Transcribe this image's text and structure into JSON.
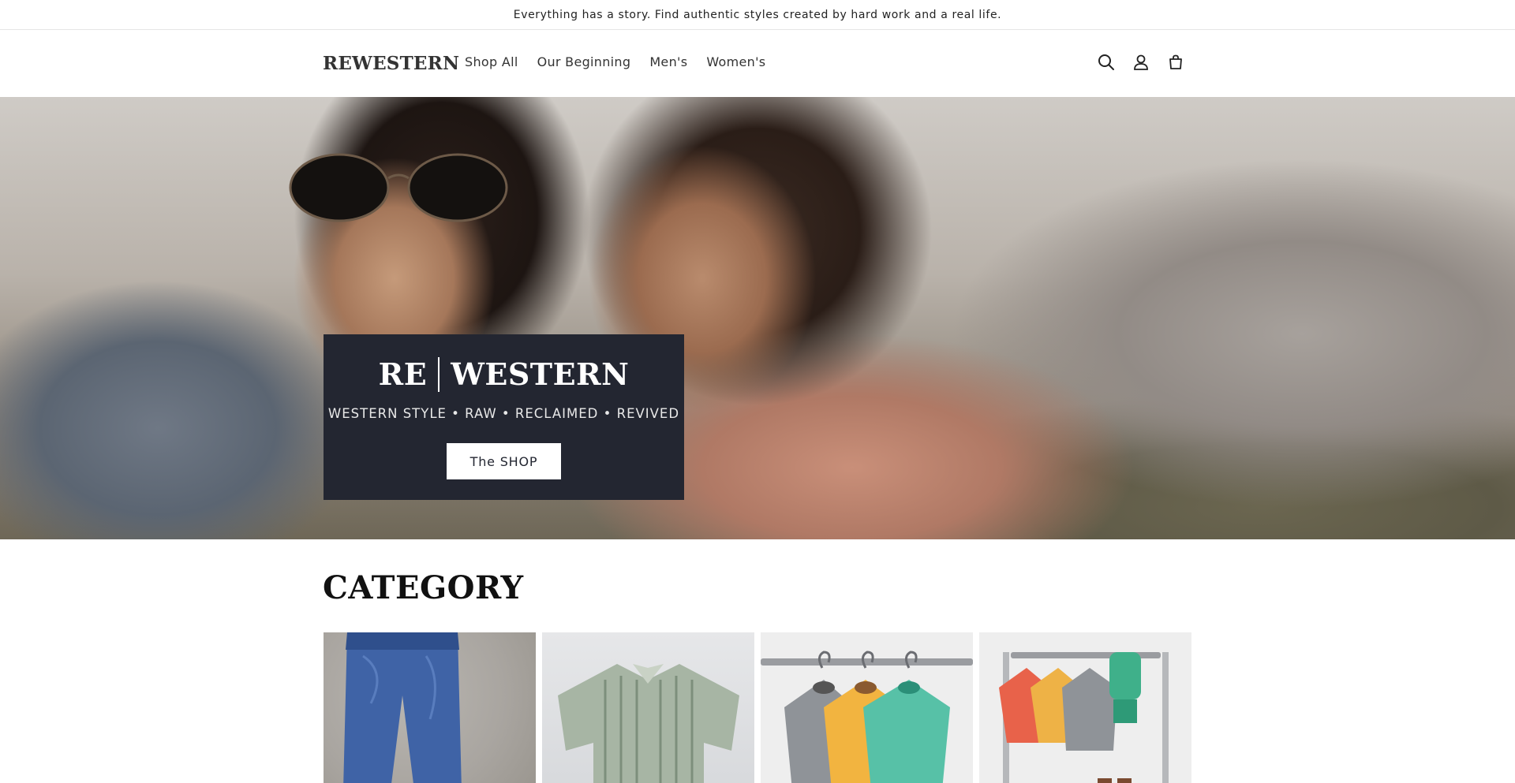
{
  "announcement": {
    "text": "Everything has a story. Find authentic styles created by hard work and a real life."
  },
  "header": {
    "logo": "REWESTERN",
    "nav": [
      {
        "label": "Shop All"
      },
      {
        "label": "Our Beginning"
      },
      {
        "label": "Men's"
      },
      {
        "label": "Women's"
      }
    ],
    "icons": [
      "search-icon",
      "account-icon",
      "cart-icon"
    ]
  },
  "hero": {
    "title_left": "RE",
    "title_right": "WESTERN",
    "subtitle": "WESTERN STYLE • RAW • RECLAIMED • REVIVED",
    "button_label": "The SHOP",
    "box_color": "#232631"
  },
  "category": {
    "title": "CATEGORY",
    "cards": [
      {
        "image": "denim-jeans-image"
      },
      {
        "image": "striped-shirt-image"
      },
      {
        "image": "hanging-sweaters-illustration"
      },
      {
        "image": "clothing-rack-illustration"
      }
    ]
  },
  "colors": {
    "text": "#121212",
    "hero_box": "#232631",
    "button_bg": "#ffffff"
  }
}
